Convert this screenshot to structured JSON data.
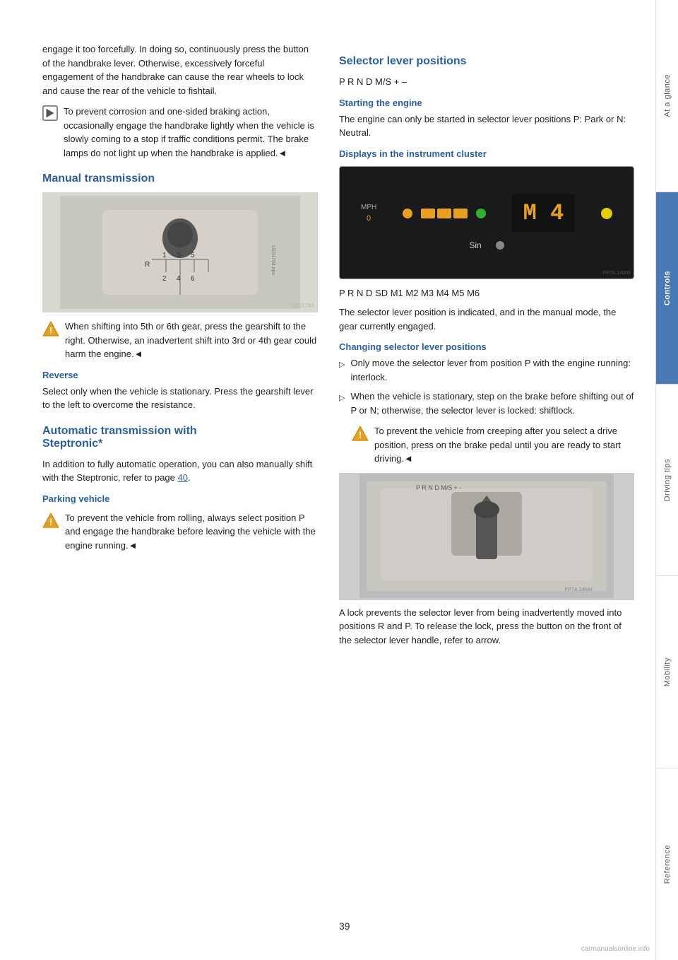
{
  "page": {
    "number": "39"
  },
  "sidebar": {
    "sections": [
      {
        "id": "at-a-glance",
        "label": "At a glance",
        "active": false
      },
      {
        "id": "controls",
        "label": "Controls",
        "active": true
      },
      {
        "id": "driving-tips",
        "label": "Driving tips",
        "active": false
      },
      {
        "id": "mobility",
        "label": "Mobility",
        "active": false
      },
      {
        "id": "reference",
        "label": "Reference",
        "active": false
      }
    ]
  },
  "left_column": {
    "intro_text": "engage it too forcefully. In doing so, continuously press the button of the handbrake lever. Otherwise, excessively forceful engagement of the handbrake can cause the rear wheels to lock and cause the rear of the vehicle to fishtail.",
    "note1": "To prevent corrosion and one-sided braking action, occasionally engage the handbrake lightly when the vehicle is slowly coming to a stop if traffic conditions permit. The brake lamps do not light up when the handbrake is applied.",
    "end_mark1": "◄",
    "manual_title": "Manual transmission",
    "gear_note": "When shifting into 5th or 6th gear, press the gearshift to the right. Otherwise, an inadvertent shift into 3rd or 4th gear could harm the engine.",
    "end_mark2": "◄",
    "reverse_title": "Reverse",
    "reverse_text": "Select only when the vehicle is stationary. Press the gearshift lever to the left to overcome the resistance.",
    "auto_title": "Automatic transmission with",
    "auto_title2": "Steptronic*",
    "auto_text": "In addition to fully automatic operation, you can also manually shift with the Steptronic, refer to page",
    "auto_page_ref": "40",
    "auto_text_end": ".",
    "parking_title": "Parking vehicle",
    "parking_note": "To prevent the vehicle from rolling, always select position P and engage the handbrake before leaving the vehicle with the engine running.",
    "end_mark3": "◄"
  },
  "right_column": {
    "selector_title": "Selector lever positions",
    "selector_positions": "P R N D M/S + –",
    "starting_title": "Starting the engine",
    "starting_text": "The engine can only be started in selector lever positions P: Park or N: Neutral.",
    "displays_title": "Displays in the instrument cluster",
    "cluster_display": "M 4",
    "cluster_label": "Sin",
    "cluster_positions": "P R N D SD M1 M2 M3 M4 M5 M6",
    "cluster_text": "The selector lever position is indicated, and in the manual mode, the gear currently engaged.",
    "changing_title": "Changing selector lever positions",
    "bullet1": "Only move the selector lever from position P with the engine running: interlock.",
    "bullet2": "When the vehicle is stationary, step on the brake before shifting out of P or N; otherwise, the selector lever is locked: shiftlock.",
    "creep_note": "To prevent the vehicle from creeping after you select a drive position, press on the brake pedal until you are ready to start driving.",
    "end_mark4": "◄",
    "lock_text": "A lock prevents the selector lever from being inadvertently moved into positions R and P. To release the lock, press the button on the front of the selector lever handle, refer to arrow."
  }
}
